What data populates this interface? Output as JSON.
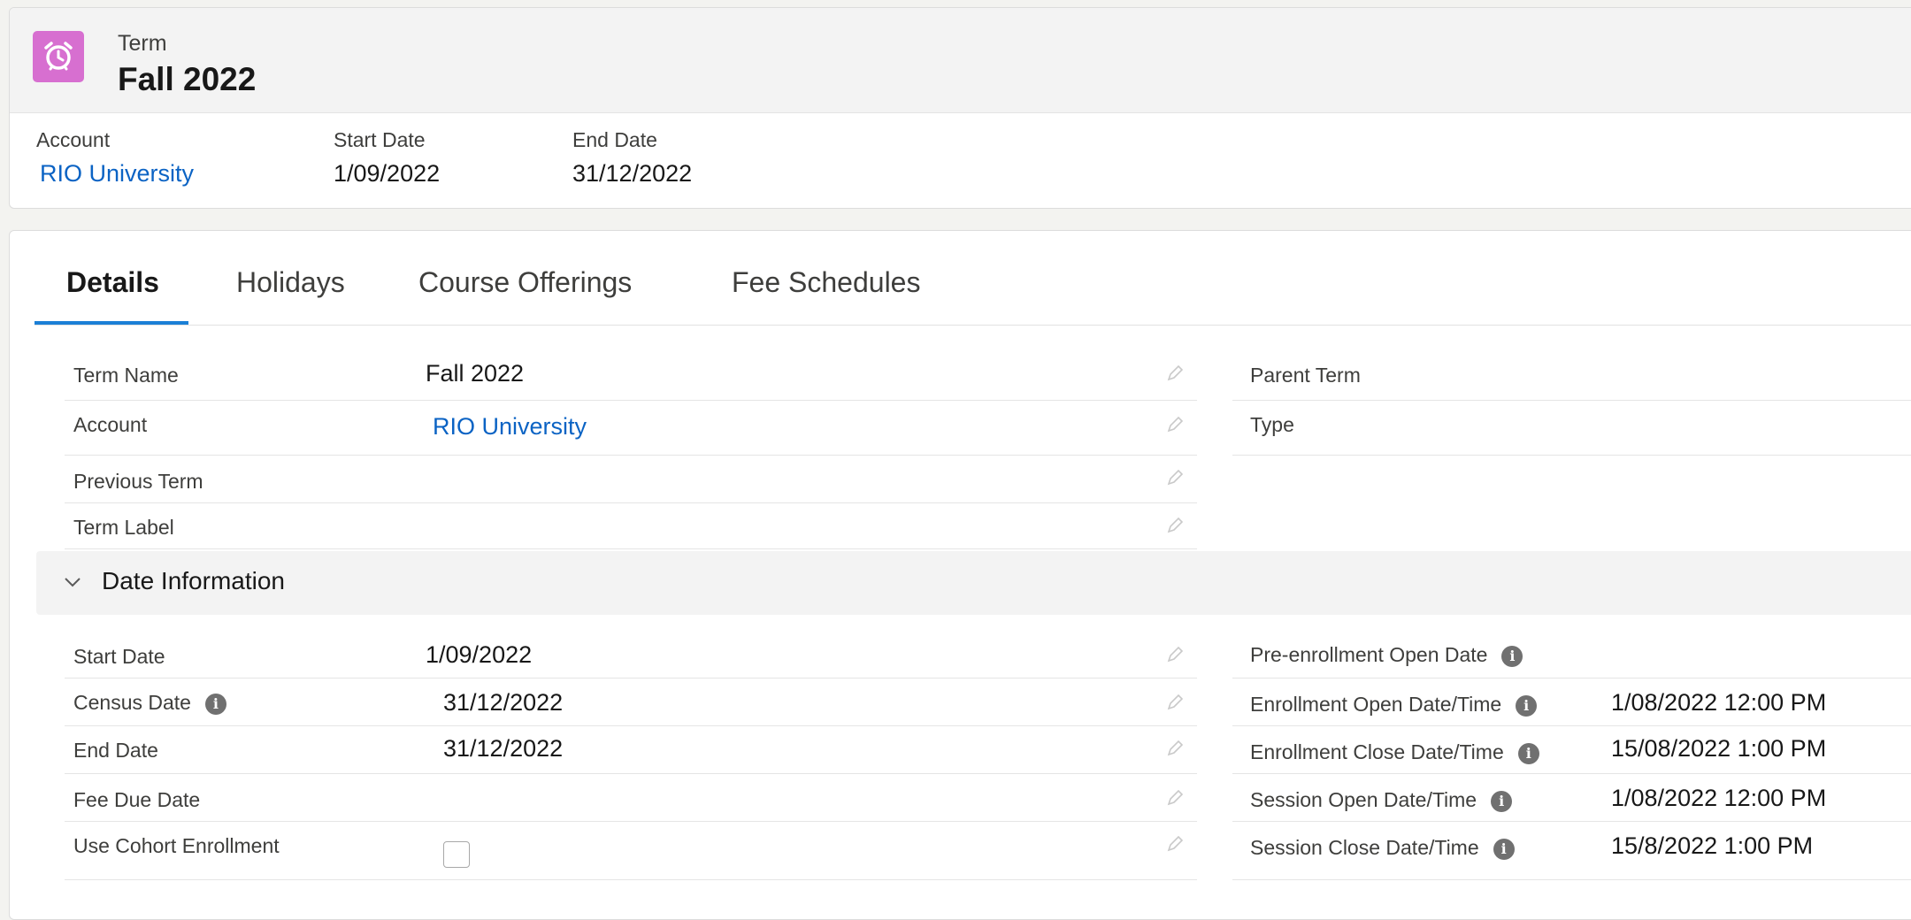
{
  "header": {
    "object_type": "Term",
    "record_name": "Fall 2022",
    "icon": "alarm-clock-icon",
    "icon_color": "#d76fd0",
    "highlights": [
      {
        "label": "Account",
        "value": "RIO University",
        "link": true
      },
      {
        "label": "Start Date",
        "value": "1/09/2022",
        "link": false
      },
      {
        "label": "End Date",
        "value": "31/12/2022",
        "link": false
      }
    ]
  },
  "tabs": [
    {
      "label": "Details",
      "active": true
    },
    {
      "label": "Holidays",
      "active": false
    },
    {
      "label": "Course Offerings",
      "active": false
    },
    {
      "label": "Fee Schedules",
      "active": false
    }
  ],
  "details": {
    "left": [
      {
        "label": "Term Name",
        "value": "Fall 2022"
      },
      {
        "label": "Account",
        "value": "RIO University",
        "link": true
      },
      {
        "label": "Previous Term",
        "value": ""
      },
      {
        "label": "Term Label",
        "value": ""
      }
    ],
    "right": [
      {
        "label": "Parent Term",
        "value": ""
      },
      {
        "label": "Type",
        "value": ""
      }
    ]
  },
  "date_section": {
    "title": "Date Information",
    "left": [
      {
        "label": "Start Date",
        "value": "1/09/2022"
      },
      {
        "label": "Census Date",
        "value": "31/12/2022",
        "info": true
      },
      {
        "label": "End Date",
        "value": "31/12/2022"
      },
      {
        "label": "Fee Due Date",
        "value": ""
      },
      {
        "label": "Use Cohort Enrollment",
        "value": "",
        "checkbox": true,
        "checked": false
      }
    ],
    "right": [
      {
        "label": "Pre-enrollment Open Date",
        "value": "",
        "info": true
      },
      {
        "label": "Enrollment Open Date/Time",
        "value": "1/08/2022 12:00 PM",
        "info": true
      },
      {
        "label": "Enrollment Close Date/Time",
        "value": "15/08/2022 1:00 PM",
        "info": true
      },
      {
        "label": "Session Open Date/Time",
        "value": "1/08/2022 12:00 PM",
        "info": true
      },
      {
        "label": "Session Close Date/Time",
        "value": "15/8/2022 1:00 PM",
        "info": true
      }
    ]
  },
  "colors": {
    "link": "#0b63c4",
    "active_tab_underline": "#1b7fd6"
  }
}
